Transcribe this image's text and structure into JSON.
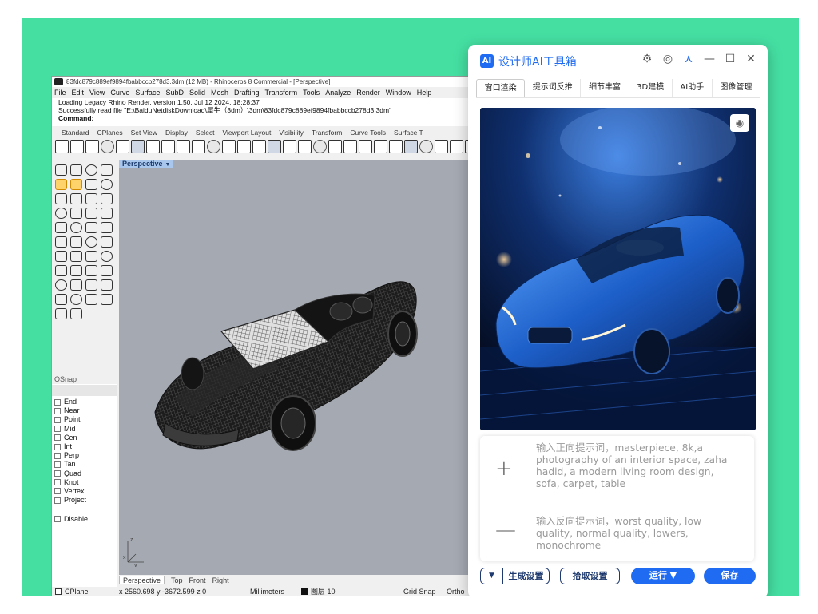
{
  "rhino": {
    "title": "83fdc879c889ef9894fbabbccb278d3.3dm (12 MB) - Rhinoceros 8 Commercial - [Perspective]",
    "menu": [
      "File",
      "Edit",
      "View",
      "Curve",
      "Surface",
      "SubD",
      "Solid",
      "Mesh",
      "Drafting",
      "Transform",
      "Tools",
      "Analyze",
      "Render",
      "Window",
      "Help"
    ],
    "command_lines": [
      "Loading Legacy Rhino Render, version 1.50, Jul 12 2024, 18:28:37",
      "Successfully read file \"E:\\BaiduNetdiskDownload\\犀牛（3dm）\\3dm\\83fdc879c889ef9894fbabbccb278d3.3dm\"",
      "Command:"
    ],
    "toolbar_tabs": [
      "Standard",
      "CPlanes",
      "Set View",
      "Display",
      "Select",
      "Viewport Layout",
      "Visibility",
      "Transform",
      "Curve Tools",
      "Surface T"
    ],
    "viewport_label": "Perspective",
    "osnap": {
      "title": "OSnap",
      "items": [
        "End",
        "Near",
        "Point",
        "Mid",
        "Cen",
        "Int",
        "Perp",
        "Tan",
        "Quad",
        "Knot",
        "Vertex",
        "Project"
      ],
      "disable": "Disable"
    },
    "viewport_tabs": [
      "Perspective",
      "Top",
      "Front",
      "Right"
    ],
    "status": {
      "cplane": "CPlane",
      "coords": "x 2560.698  y -3672.599  z 0",
      "units": "Millimeters",
      "layer": "图层 10",
      "grid_snap": "Grid Snap",
      "ortho": "Ortho"
    }
  },
  "panel": {
    "logo": "AI",
    "title": "设计师AI工具箱",
    "controls": {
      "settings": "⚙",
      "target": "◎",
      "pin": "⋏",
      "minimize": "—",
      "maximize": "☐",
      "close": "✕"
    },
    "tabs": [
      "窗口渲染",
      "提示词反推",
      "细节丰富",
      "3D建模",
      "AI助手",
      "图像管理"
    ],
    "active_tab": "窗口渲染",
    "positive_prompt": "输入正向提示词，masterpiece, 8k,a photography of an interior space, zaha hadid, a modern living room design, sofa, carpet, table",
    "negative_prompt": "输入反向提示词，worst quality, low quality, normal quality, lowers, monochrome",
    "plus": "+",
    "minus": "—",
    "buttons": {
      "dropdown_arrow": "▼",
      "generate_settings": "生成设置",
      "pick_settings": "拾取设置",
      "run": "运行 ▼",
      "save": "保存"
    },
    "accent": "#1f6bf2"
  },
  "colors": {
    "background": "#45dfa2",
    "viewport": "#a5a9b2"
  }
}
